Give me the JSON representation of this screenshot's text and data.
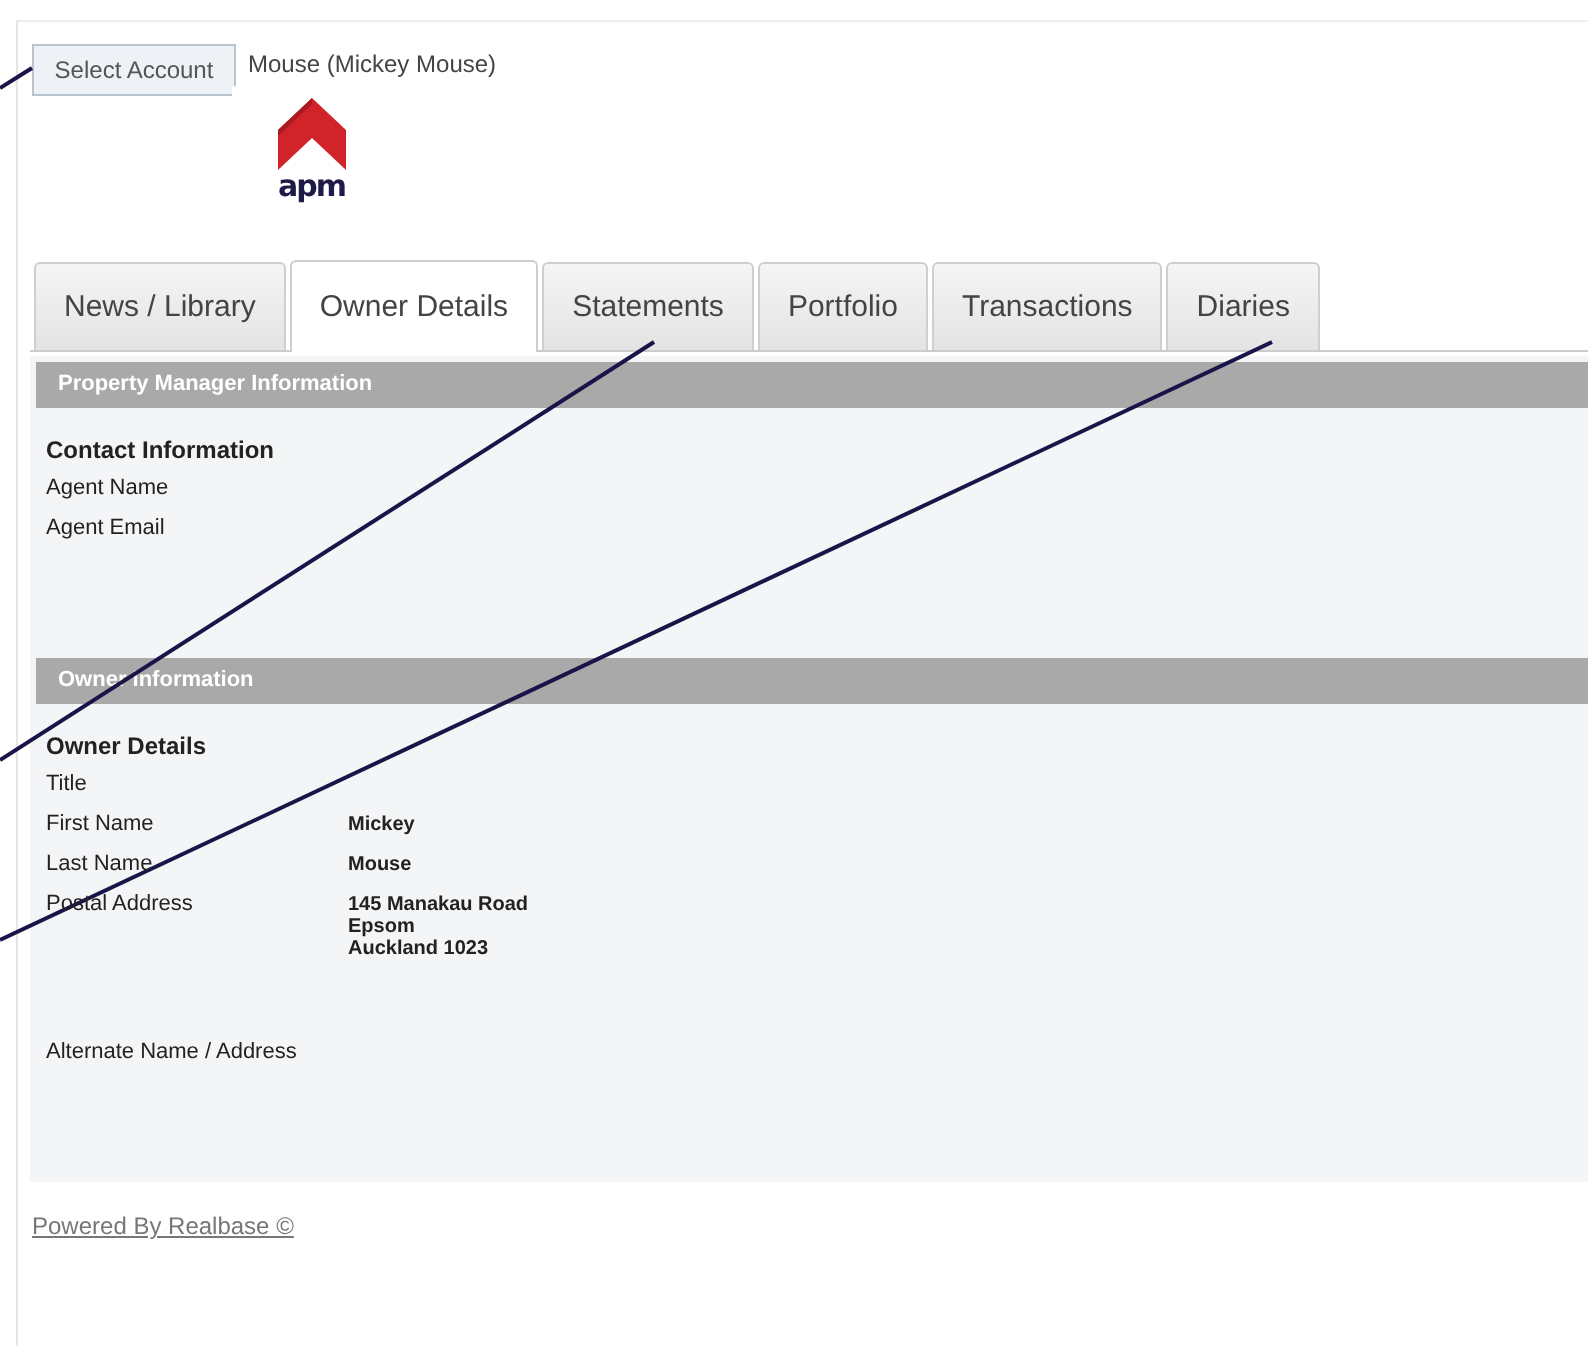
{
  "header": {
    "select_account_button": "Select Account",
    "account_name": "Mouse (Mickey Mouse)",
    "logo_text": "apm"
  },
  "tabs": [
    {
      "label": "News / Library",
      "selected": false
    },
    {
      "label": "Owner Details",
      "selected": true
    },
    {
      "label": "Statements",
      "selected": false
    },
    {
      "label": "Portfolio",
      "selected": false
    },
    {
      "label": "Transactions",
      "selected": false
    },
    {
      "label": "Diaries",
      "selected": false
    }
  ],
  "sections": [
    {
      "title": "Property Manager Information",
      "rows": [
        {
          "kind": "heading",
          "label": "Contact Information"
        },
        {
          "kind": "field",
          "label": "Agent Name"
        },
        {
          "kind": "field",
          "label": "Agent Email"
        }
      ]
    },
    {
      "title": "Owner Information",
      "rows": [
        {
          "kind": "heading",
          "label": "Owner Details"
        },
        {
          "kind": "field",
          "label": "Title"
        },
        {
          "kind": "field",
          "label": "First Name",
          "value": [
            "Mickey"
          ]
        },
        {
          "kind": "field",
          "label": "Last Name",
          "value": [
            "Mouse"
          ]
        },
        {
          "kind": "field",
          "label": "Postal Address",
          "value": [
            "145 Manakau Road",
            "Epsom",
            "Auckland 1023"
          ]
        },
        {
          "kind": "gap"
        },
        {
          "kind": "field",
          "label": "Alternate Name / Address"
        }
      ]
    }
  ],
  "footer": {
    "link": "Powered By Realbase ©"
  }
}
